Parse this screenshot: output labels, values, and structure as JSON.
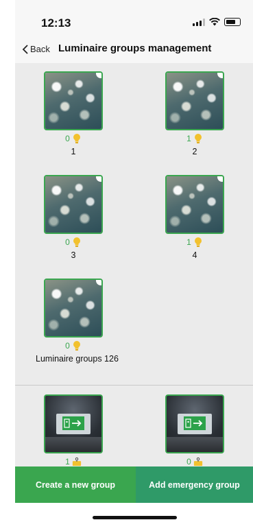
{
  "status_bar": {
    "time": "12:13"
  },
  "nav": {
    "back_label": "Back",
    "title": "Luminaire groups management"
  },
  "groups": [
    {
      "count": "0",
      "name": "1"
    },
    {
      "count": "1",
      "name": "2"
    },
    {
      "count": "0",
      "name": "3"
    },
    {
      "count": "1",
      "name": "4"
    },
    {
      "count": "0",
      "name": "Luminaire groups 126"
    }
  ],
  "emergency_groups": [
    {
      "count": "1"
    },
    {
      "count": "0"
    }
  ],
  "buttons": {
    "create": "Create a new group",
    "emergency": "Add emergency group"
  },
  "colors": {
    "accent": "#3aa64f",
    "emergency": "#2f9a68",
    "bulb": "#f2c12e"
  }
}
